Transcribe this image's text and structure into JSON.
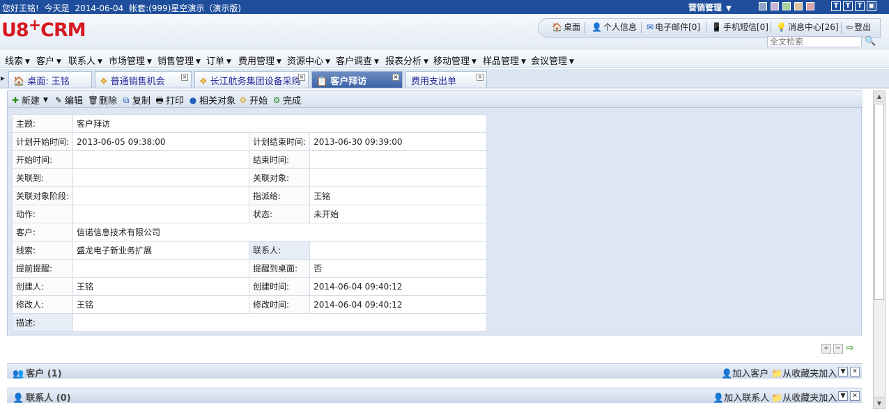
{
  "topbar": {
    "greeting": "您好王铭!",
    "today": "今天是",
    "date": "2014-06-04",
    "account": "帐套:(999)星空演示（演示版)",
    "module": "营销管理"
  },
  "header": {
    "logo_main": "U8",
    "logo_plus": "+",
    "logo_suffix": "CRM",
    "quick": [
      {
        "label": "桌面",
        "icon": "home-icon"
      },
      {
        "label": "个人信息",
        "icon": "user-icon"
      },
      {
        "label": "电子邮件[0]",
        "icon": "mail-icon"
      },
      {
        "label": "手机短信[0]",
        "icon": "phone-icon"
      },
      {
        "label": "消息中心[26]",
        "icon": "bulb-icon"
      },
      {
        "label": "登出",
        "icon": "logout-icon"
      }
    ],
    "search_placeholder": "全文检索"
  },
  "menu": [
    "线索",
    "客户",
    "联系人",
    "市场管理",
    "销售管理",
    "订单",
    "费用管理",
    "资源中心",
    "客户调查",
    "报表分析",
    "移动管理",
    "样品管理",
    "会议管理"
  ],
  "tabs": [
    {
      "label": "桌面: 王铭",
      "icon": "home-icon"
    },
    {
      "label": "普通销售机会",
      "icon": "opportunity-icon"
    },
    {
      "label": "长江航务集团设备采购",
      "icon": "opportunity-icon"
    },
    {
      "label": "客户拜访",
      "icon": "visit-icon"
    },
    {
      "label": "费用支出单",
      "icon": ""
    }
  ],
  "toolbar": {
    "new": "新建",
    "edit": "编辑",
    "delete": "删除",
    "copy": "复制",
    "print": "打印",
    "related": "相关对象",
    "start": "开始",
    "finish": "完成"
  },
  "detail": {
    "subject_label": "主题:",
    "subject": "客户拜访",
    "plan_start_label": "计划开始时间:",
    "plan_start": "2013-06-05 09:38:00",
    "plan_end_label": "计划结束时间:",
    "plan_end": "2013-06-30 09:39:00",
    "start_label": "开始时间:",
    "start": "",
    "end_label": "结束时间:",
    "end": "",
    "related_to_label": "关联到:",
    "related_to": "",
    "related_obj_label": "关联对象:",
    "related_obj": "",
    "related_stage_label": "关联对象阶段:",
    "related_stage": "",
    "assign_label": "指派给:",
    "assign": "王铭",
    "action_label": "动作:",
    "action": "",
    "status_label": "状态:",
    "status": "未开始",
    "customer_label": "客户:",
    "customer": "信诺信息技术有限公司",
    "lead_label": "线索:",
    "lead": "盛龙电子新业务扩展",
    "contact_label": "联系人:",
    "contact": "",
    "remind_label": "提前提醒:",
    "remind": "",
    "remind_desk_label": "提醒到桌面:",
    "remind_desk": "否",
    "creator_label": "创建人:",
    "creator": "王铭",
    "created_label": "创建时间:",
    "created": "2014-06-04 09:40:12",
    "modifier_label": "修改人:",
    "modifier": "王铭",
    "modified_label": "修改时间:",
    "modified": "2014-06-04 09:40:12",
    "desc_label": "描述:",
    "desc": ""
  },
  "sections": [
    {
      "title": "客户",
      "count": "(1)",
      "add": "加入客户",
      "fav": "从收藏夹加入"
    },
    {
      "title": "联系人",
      "count": "(0)",
      "add": "加入联系人",
      "fav": "从收藏夹加入"
    }
  ]
}
